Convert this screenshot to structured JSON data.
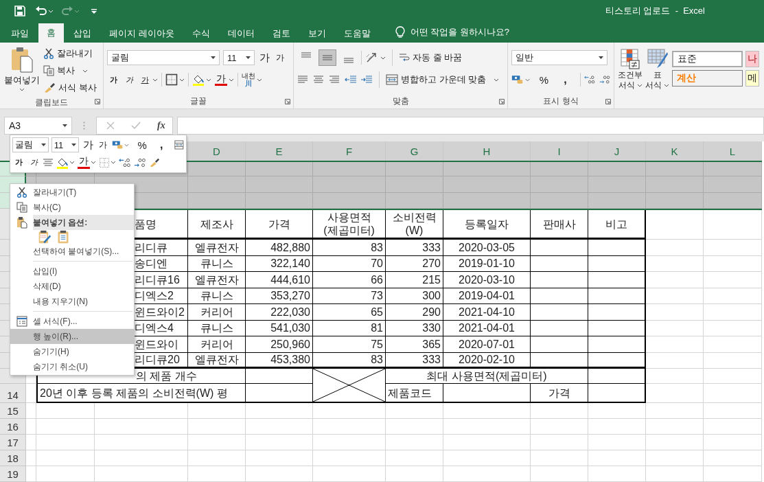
{
  "window": {
    "title": "티스토리 업로드  -  Excel"
  },
  "quick_access": {
    "redo": {
      "disabled": true
    }
  },
  "tabs": [
    {
      "label": "파일",
      "selected": false
    },
    {
      "label": "홈",
      "selected": true
    },
    {
      "label": "삽입",
      "selected": false
    },
    {
      "label": "페이지 레이아웃",
      "selected": false
    },
    {
      "label": "수식",
      "selected": false
    },
    {
      "label": "데이터",
      "selected": false
    },
    {
      "label": "검토",
      "selected": false
    },
    {
      "label": "보기",
      "selected": false
    },
    {
      "label": "도움말",
      "selected": false
    }
  ],
  "tell_me": {
    "placeholder": "어떤 작업을 원하시나요?"
  },
  "ribbon": {
    "clipboard": {
      "label": "클립보드",
      "paste": "붙여넣기",
      "cut": "잘라내기",
      "copy": "복사",
      "format_painter": "서식 복사"
    },
    "font": {
      "label": "글꼴",
      "font_name": "굴림",
      "font_size": "11",
      "grow": "가",
      "shrink": "가",
      "bold": "가",
      "italic": "가",
      "underline": "가",
      "font_color": "가",
      "phonetic": "내천",
      "phonetic_mark": "川"
    },
    "alignment": {
      "label": "맞춤",
      "wrap": "자동 줄 바꿈",
      "merge": "병합하고 가운데 맞춤",
      "vertical": [
        {
          "kind": "top",
          "selected": false
        },
        {
          "kind": "middle",
          "selected": true
        },
        {
          "kind": "bottom",
          "selected": false
        }
      ]
    },
    "number": {
      "label": "표시 형식",
      "format": "일반",
      "percent": "%",
      "comma": ","
    },
    "styles": {
      "conditional": "조건부",
      "conditional_2": "서식",
      "table": "표",
      "table_2": "서식",
      "cells": [
        {
          "label": "표준",
          "kind": "normal"
        },
        {
          "label": "나",
          "kind": "bad"
        },
        {
          "label": "계산",
          "kind": "calculation"
        },
        {
          "label": "메",
          "kind": "note"
        }
      ]
    }
  },
  "formula_bar": {
    "name_box": "A3",
    "function_label": "fx"
  },
  "mini_toolbar": {
    "font_name": "굴림",
    "font_size": "11",
    "grow": "가",
    "shrink": "가",
    "percent": "%",
    "comma": ",",
    "bold": "가",
    "italic": "가",
    "font_color": "가"
  },
  "columns": [
    "D",
    "E",
    "F",
    "G",
    "H",
    "I",
    "J",
    "K",
    "L"
  ],
  "row_headers": [
    {
      "selected": true
    },
    {
      "selected": true
    },
    {
      "selected": true
    },
    {
      "selected": false
    },
    {
      "selected": false
    },
    {
      "selected": false
    },
    {
      "selected": false
    },
    {
      "selected": false
    },
    {
      "selected": false
    },
    {
      "selected": false
    },
    {
      "selected": false
    },
    {
      "selected": false
    },
    {
      "selected": false
    },
    {
      "label": "14",
      "selected": false
    },
    {
      "label": "15",
      "selected": false
    },
    {
      "label": "16",
      "selected": false
    },
    {
      "label": "17",
      "selected": false
    },
    {
      "label": "18",
      "selected": false
    },
    {
      "label": "19",
      "selected": false
    }
  ],
  "table": {
    "header": [
      "품명",
      "제조사",
      "가격",
      "사용면적\n(제곱미터)",
      "소비전력\n(W)",
      "등록일자",
      "판매사",
      "비고"
    ],
    "rows": [
      [
        "리디큐",
        "엘큐전자",
        "482,880",
        "83",
        "333",
        "2020-03-05"
      ],
      [
        "송디엔",
        "큐니스",
        "322,140",
        "70",
        "270",
        "2019-01-10"
      ],
      [
        "리디큐16",
        "엘큐전자",
        "444,610",
        "66",
        "215",
        "2020-03-10"
      ],
      [
        "디엑스2",
        "큐니스",
        "353,270",
        "73",
        "300",
        "2019-04-01"
      ],
      [
        "윈드와이2",
        "커리어",
        "222,030",
        "65",
        "290",
        "2021-04-10"
      ],
      [
        "디엑스4",
        "큐니스",
        "541,030",
        "81",
        "330",
        "2021-04-01"
      ],
      [
        "윈드와이",
        "커리어",
        "250,960",
        "75",
        "365",
        "2020-07-01"
      ],
      [
        "리디큐20",
        "엘큐전자",
        "453,380",
        "83",
        "333",
        "2020-02-10"
      ]
    ],
    "count_label": "의 제품 개수",
    "avg_label": "20년 이후 등록 제품의 소비전력(W) 평",
    "max_label": "최대 사용면적(제곱미터)",
    "code_label": "제품코드",
    "price_label": "가격"
  },
  "context_menu": [
    {
      "kind": "item",
      "label": "잘라내기(T)",
      "selected": false
    },
    {
      "kind": "item",
      "label": "복사(C)",
      "selected": false
    },
    {
      "kind": "header",
      "label": "붙여넣기 옵션:"
    },
    {
      "kind": "paste_icons"
    },
    {
      "kind": "item",
      "label": "선택하여 붙여넣기(S)...",
      "selected": false
    },
    {
      "kind": "separator"
    },
    {
      "kind": "item",
      "label": "삽입(I)",
      "selected": false
    },
    {
      "kind": "item",
      "label": "삭제(D)",
      "selected": false
    },
    {
      "kind": "item",
      "label": "내용 지우기(N)",
      "selected": false
    },
    {
      "kind": "separator"
    },
    {
      "kind": "item",
      "label": "셀 서식(F)...",
      "selected": false
    },
    {
      "kind": "item",
      "label": "행 높이(R)...",
      "selected": true
    },
    {
      "kind": "item",
      "label": "숨기기(H)",
      "selected": false
    },
    {
      "kind": "item",
      "label": "숨기기 취소(U)",
      "selected": false
    }
  ]
}
